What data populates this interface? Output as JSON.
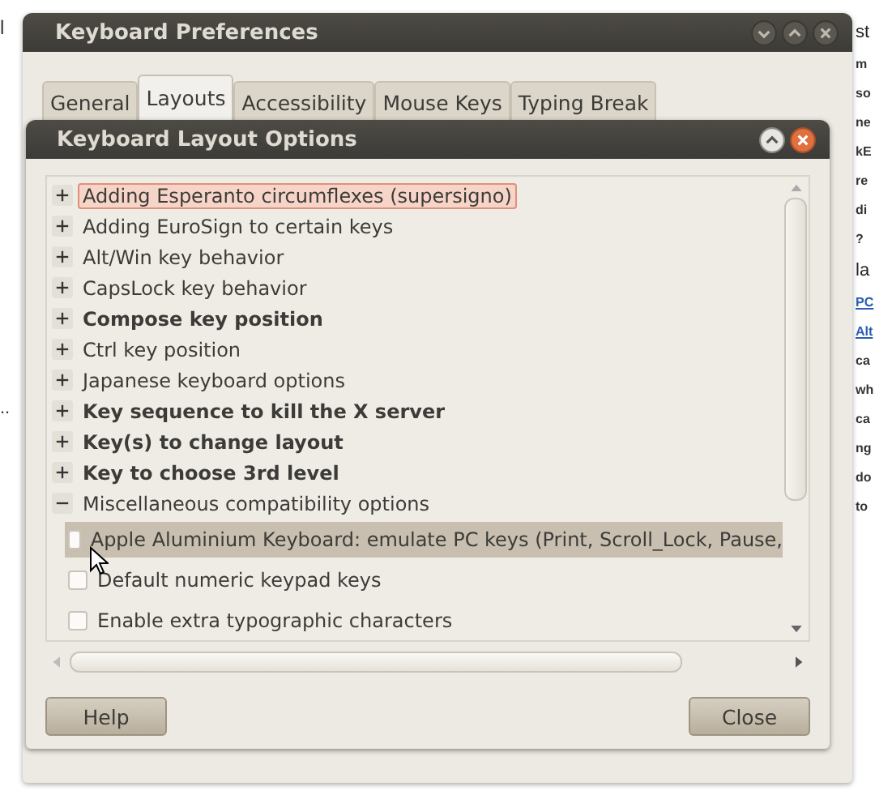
{
  "background": {
    "left_fragments": [
      "l",
      ".."
    ],
    "right_fragments": [
      {
        "text": "st",
        "kind": "heading"
      },
      {
        "text": "m",
        "kind": "bold"
      },
      {
        "text": "so",
        "kind": "bold"
      },
      {
        "text": "ne",
        "kind": "bold"
      },
      {
        "text": "kE",
        "kind": "bold"
      },
      {
        "text": "re",
        "kind": "bold"
      },
      {
        "text": "di",
        "kind": "bold"
      },
      {
        "text": "?",
        "kind": "bold"
      },
      {
        "text": "la",
        "kind": "heading"
      },
      {
        "text": "PC",
        "kind": "link"
      },
      {
        "text": "Alt",
        "kind": "link"
      },
      {
        "text": "ca",
        "kind": "bold"
      },
      {
        "text": "wh",
        "kind": "bold"
      },
      {
        "text": "ca",
        "kind": "bold"
      },
      {
        "text": "ng",
        "kind": "bold"
      },
      {
        "text": "do",
        "kind": "bold"
      },
      {
        "text": "to",
        "kind": "bold"
      }
    ]
  },
  "window": {
    "title": "Keyboard Preferences",
    "tabs": [
      {
        "label": "General",
        "selected": false
      },
      {
        "label": "Layouts",
        "selected": true
      },
      {
        "label": "Accessibility",
        "selected": false
      },
      {
        "label": "Mouse Keys",
        "selected": false
      },
      {
        "label": "Typing Break",
        "selected": false
      }
    ]
  },
  "dialog": {
    "title": "Keyboard Layout Options",
    "options": [
      {
        "label": "Adding Esperanto circumflexes (supersigno)",
        "bold": false,
        "expanded": false,
        "focused": true
      },
      {
        "label": "Adding EuroSign to certain keys",
        "bold": false,
        "expanded": false,
        "focused": false
      },
      {
        "label": "Alt/Win key behavior",
        "bold": false,
        "expanded": false,
        "focused": false
      },
      {
        "label": "CapsLock key behavior",
        "bold": false,
        "expanded": false,
        "focused": false
      },
      {
        "label": "Compose key position",
        "bold": true,
        "expanded": false,
        "focused": false
      },
      {
        "label": "Ctrl key position",
        "bold": false,
        "expanded": false,
        "focused": false
      },
      {
        "label": "Japanese keyboard options",
        "bold": false,
        "expanded": false,
        "focused": false
      },
      {
        "label": "Key sequence to kill the X server",
        "bold": true,
        "expanded": false,
        "focused": false
      },
      {
        "label": "Key(s) to change layout",
        "bold": true,
        "expanded": false,
        "focused": false
      },
      {
        "label": "Key to choose 3rd level",
        "bold": true,
        "expanded": false,
        "focused": false
      },
      {
        "label": "Miscellaneous compatibility options",
        "bold": false,
        "expanded": true,
        "focused": false,
        "children": [
          {
            "label": "Apple Aluminium Keyboard: emulate PC keys (Print, Scroll_Lock, Pause,",
            "checked": false,
            "selected": true
          },
          {
            "label": "Default numeric keypad keys",
            "checked": false,
            "selected": false
          },
          {
            "label": "Enable extra typographic characters",
            "checked": false,
            "selected": false
          }
        ]
      }
    ],
    "buttons": [
      "Help",
      "Close"
    ]
  }
}
